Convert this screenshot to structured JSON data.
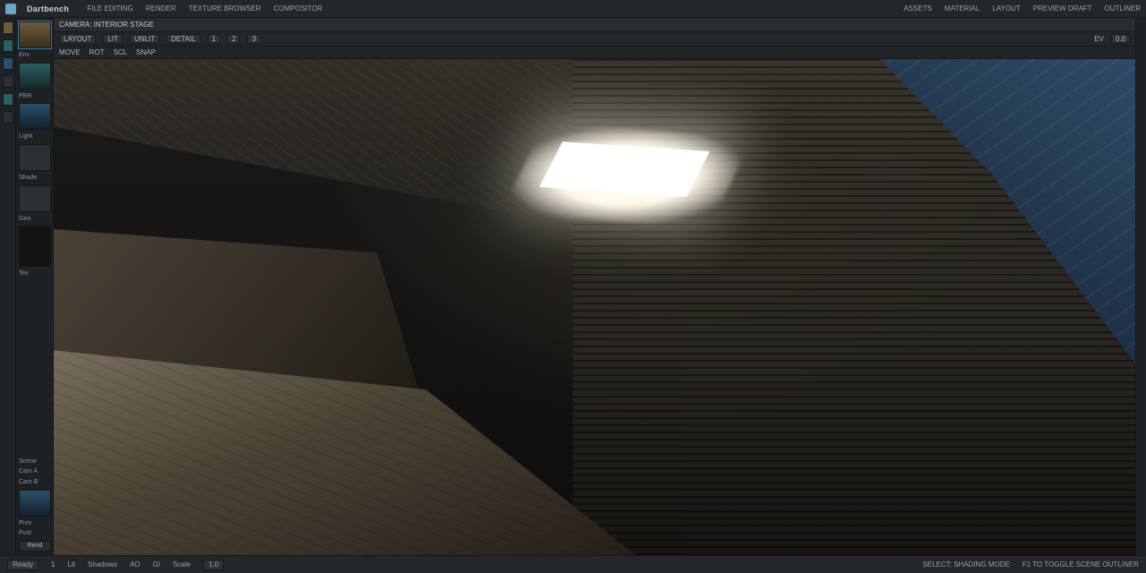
{
  "app": {
    "name": "Dartbench"
  },
  "menubar": {
    "left": [
      "FILE EDITING",
      "RENDER",
      "TEXTURE BROWSER",
      "COMPOSITOR"
    ],
    "right": [
      "ASSETS",
      "MATERIAL",
      "LAYOUT",
      "PREVIEW DRAFT",
      "OUTLINER"
    ]
  },
  "viewport": {
    "header_title": "CAMERA: INTERIOR STAGE",
    "tools": [
      "LAYOUT",
      "LIT",
      "UNLIT",
      "DETAIL"
    ],
    "numbered": [
      "1",
      "2",
      "3"
    ],
    "secondary": [
      "MOVE",
      "ROT",
      "SCL",
      "SNAP"
    ],
    "exposure_label": "EV",
    "exposure_value": "0.0"
  },
  "left_panel": {
    "labels_top": [
      "Env",
      "PBR",
      "Light",
      "Shade",
      "Geo",
      "Tex"
    ],
    "labels_bottom": [
      "Scene",
      "Cam A",
      "Cam B",
      "Prev",
      "Post"
    ],
    "mini": "Rend"
  },
  "statusbar": {
    "ready": "Ready",
    "cursor": "1",
    "items": [
      "Lit",
      "Shadows",
      "AO",
      "GI"
    ],
    "center_hint": "SELECT: SHADING MODE",
    "right_hint": "F1 TO TOGGLE SCENE OUTLINER",
    "scale_label": "Scale",
    "scale_value": "1.0"
  }
}
